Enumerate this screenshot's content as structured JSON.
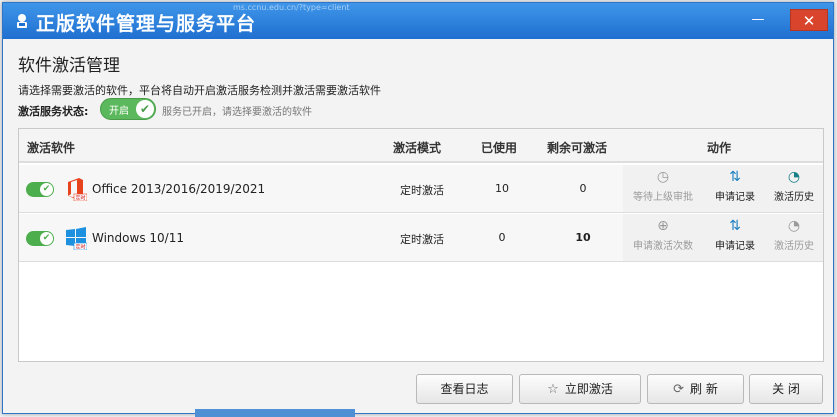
{
  "window": {
    "title": "正版软件管理与服务平台",
    "url_hint": "ms.ccnu.edu.cn/?type=client",
    "minimize_glyph": "—",
    "close_glyph": "✕"
  },
  "page": {
    "heading": "软件激活管理",
    "description": "请选择需要激活的软件，平台将自动开启激活服务检测并激活需要激活软件",
    "status_label": "激活服务状态:",
    "status_switch_text": "开启",
    "status_hint": "服务已开启，请选择要激活的软件"
  },
  "table": {
    "headers": {
      "software": "激活软件",
      "mode": "激活模式",
      "used": "已使用",
      "remaining": "剩余可激活",
      "actions": "动作"
    },
    "rows": [
      {
        "name": "Office 2013/2016/2019/2021",
        "icon": "office-icon",
        "icon_badge": "定时",
        "mode": "定时激活",
        "used": "10",
        "remaining": "0",
        "action1": "等待上级审批",
        "action1_icon": "clock-icon",
        "action2": "申请记录",
        "action2_icon": "swap-arrows-icon",
        "action3": "激活历史",
        "action3_icon": "history-icon"
      },
      {
        "name": "Windows 10/11",
        "icon": "windows-icon",
        "icon_badge": "定时",
        "mode": "定时激活",
        "used": "0",
        "remaining": "10",
        "action1": "申请激活次数",
        "action1_icon": "plus-circle-icon",
        "action2": "申请记录",
        "action2_icon": "swap-arrows-icon",
        "action3": "激活历史",
        "action3_icon": "history-icon"
      }
    ]
  },
  "footer": {
    "log_button": "查看日志",
    "activate_button": "立即激活",
    "refresh_button": "刷 新",
    "close_button": "关 闭"
  },
  "colors": {
    "titlebar": "#2a7fdc",
    "toggle_on": "#4cae4c",
    "close_button": "#d9442c",
    "office_red": "#e8431f",
    "windows_blue": "#1e90e0"
  }
}
